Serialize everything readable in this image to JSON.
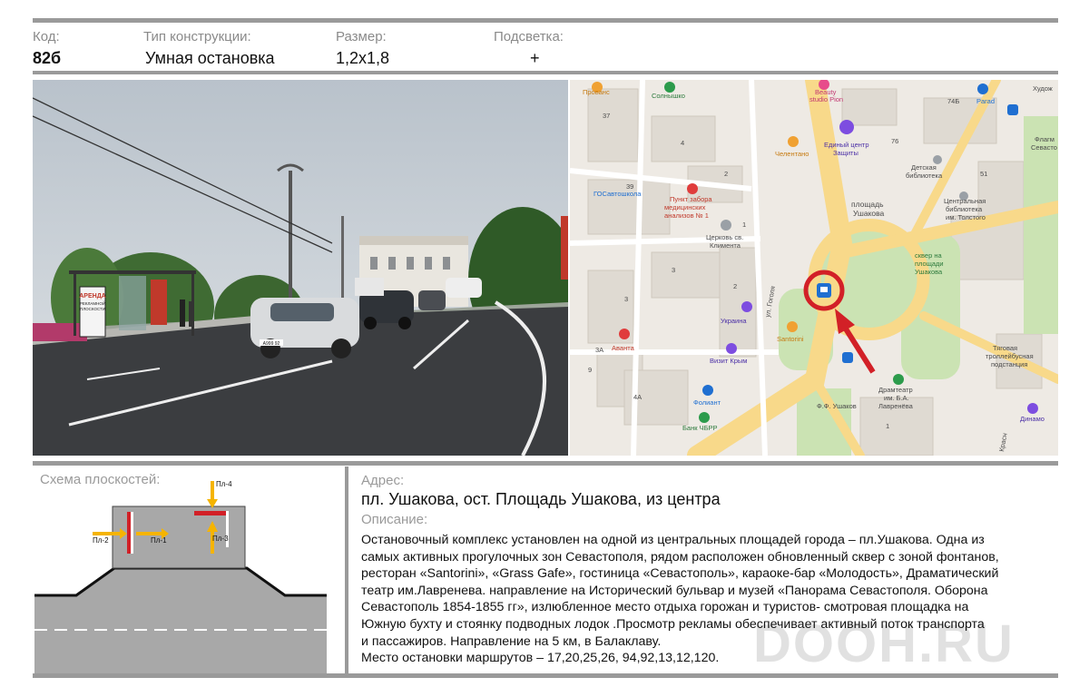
{
  "header": {
    "code_label": "Код:",
    "code_value": "82б",
    "type_label": "Тип конструкции:",
    "type_value": "Умная остановка",
    "size_label": "Размер:",
    "size_value": "1,2х1,8",
    "light_label": "Подсветка:",
    "light_value": "+"
  },
  "photo": {
    "billboard_lines": [
      "АРЕНДА",
      "РЕКЛАМНОЙ",
      "ПЛОСКОСТИ"
    ],
    "plate": "А999 92"
  },
  "map": {
    "labels": [
      {
        "text": "Прованс"
      },
      {
        "text": "Солнышко"
      },
      {
        "text": "Beauty"
      },
      {
        "text": "studio Pion"
      },
      {
        "text": "74Б"
      },
      {
        "text": "Parad"
      },
      {
        "text": "Худож"
      },
      {
        "text": "37"
      },
      {
        "text": "4"
      },
      {
        "text": "Единый центр"
      },
      {
        "text": "Защиты"
      },
      {
        "text": "76"
      },
      {
        "text": "Флагм"
      },
      {
        "text": "Севасто"
      },
      {
        "text": "Челентано"
      },
      {
        "text": "Детская"
      },
      {
        "text": "библиотека"
      },
      {
        "text": "51"
      },
      {
        "text": "39"
      },
      {
        "text": "2"
      },
      {
        "text": "ГОСавтошкола"
      },
      {
        "text": "Пункт забора"
      },
      {
        "text": "медицинских"
      },
      {
        "text": "анализов № 1"
      },
      {
        "text": "площадь"
      },
      {
        "text": "Ушакова"
      },
      {
        "text": "Центральная"
      },
      {
        "text": "библиотека"
      },
      {
        "text": "им. Толстого"
      },
      {
        "text": "Церковь св."
      },
      {
        "text": "Климента"
      },
      {
        "text": "1"
      },
      {
        "text": "сквер на"
      },
      {
        "text": "площади"
      },
      {
        "text": "Ушакова"
      },
      {
        "text": "3"
      },
      {
        "text": "ул. Гоголя"
      },
      {
        "text": "3"
      },
      {
        "text": "2"
      },
      {
        "text": "Украина"
      },
      {
        "text": "Santorini"
      },
      {
        "text": "Аванта"
      },
      {
        "text": "3А"
      },
      {
        "text": "Визит Крым"
      },
      {
        "text": "Тяговая"
      },
      {
        "text": "троллейбусная"
      },
      {
        "text": "подстанция"
      },
      {
        "text": "9"
      },
      {
        "text": "4А"
      },
      {
        "text": "Драмтеатр"
      },
      {
        "text": "им. Б.А."
      },
      {
        "text": "Лавренёва"
      },
      {
        "text": "Фолиант"
      },
      {
        "text": "Ф.Ф. Ушаков"
      },
      {
        "text": "Банк ЧБРР"
      },
      {
        "text": "1"
      },
      {
        "text": "Динамо"
      },
      {
        "text": "Красн"
      }
    ]
  },
  "scheme": {
    "title": "Схема плоскостей:",
    "labels": [
      "Пл-4",
      "Пл-1",
      "Пл-2",
      "Пл-3"
    ]
  },
  "address": {
    "label": "Адрес:",
    "value": "пл. Ушакова, ост. Площадь Ушакова, из центра"
  },
  "description": {
    "label": "Описание:",
    "lines": [
      "Остановочный комплекс установлен на одной из центральных площадей города – пл.Ушакова. Одна из",
      "самых активных прогулочных зон Севастополя, рядом расположен обновленный сквер с зоной фонтанов,",
      "ресторан «Santorini», «Grass Gafe», гостиница «Севастополь», караоке-бар «Молодость», Драматический",
      "театр им.Лавренева. направление на Исторический бульвар и музей «Панорама Севастополя. Оборона",
      "Севастополь 1854-1855 гг», излюбленное место отдыха горожан и туристов- смотровая площадка на",
      "Южную бухту и стоянку подводных лодок .Просмотр рекламы обеспечивает активный поток транспорта",
      "и пассажиров. Направление на 5 км, в Балаклаву.",
      "Место остановки маршрутов – 17,20,25,26, 94,92,13,12,120."
    ]
  },
  "watermark": "DOOH.RU",
  "colors": {
    "accent_red": "#d22027",
    "separator": "#9a9a9a",
    "arrow_yellow": "#f5b400"
  }
}
